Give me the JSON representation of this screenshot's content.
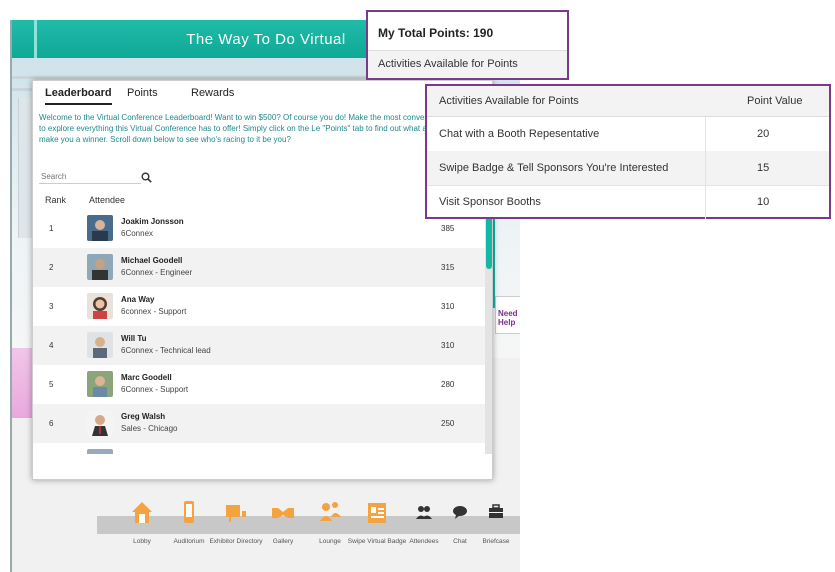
{
  "app": {
    "title": "The Way To Do Virtual",
    "help_sign": "Need Help"
  },
  "leaderboard": {
    "tabs": [
      "Leaderboard",
      "Points",
      "Rewards"
    ],
    "welcome_text": "Welcome to the Virtual Conference Leaderboard! Want to win $500? Of course you do! Make the most convenient opportunity to explore everything this Virtual Conference has to offer! Simply click on the Le \"Points\" tab to find out what actions could make you a winner. Scroll down below to see who's racing to it be you?",
    "search_placeholder": "Search",
    "columns": {
      "rank": "Rank",
      "attendee": "Attendee"
    },
    "rows": [
      {
        "rank": "1",
        "name": "Joakim Jonsson",
        "org": "6Connex",
        "points": "385"
      },
      {
        "rank": "2",
        "name": "Michael Goodell",
        "org": "6Connex - Engineer",
        "points": "315"
      },
      {
        "rank": "3",
        "name": "Ana Way",
        "org": "6connex - Support",
        "points": "310"
      },
      {
        "rank": "4",
        "name": "Will Tu",
        "org": "6Connex - Technical lead",
        "points": "310"
      },
      {
        "rank": "5",
        "name": "Marc Goodell",
        "org": "6Connex - Support",
        "points": "280"
      },
      {
        "rank": "6",
        "name": "Greg Walsh",
        "org": "Sales - Chicago",
        "points": "250"
      }
    ]
  },
  "points_summary": {
    "total": "My Total Points: 190",
    "activities_link": "Activities Available for Points"
  },
  "activities_table": {
    "header_activity": "Activities Available for Points",
    "header_value": "Point Value",
    "rows": [
      {
        "activity": "Chat with a Booth Repesentative",
        "value": "20"
      },
      {
        "activity": "Swipe Badge & Tell Sponsors You're Interested",
        "value": "15"
      },
      {
        "activity": "Visit Sponsor Booths",
        "value": "10"
      }
    ]
  },
  "bottom_nav": [
    {
      "label": "Lobby"
    },
    {
      "label": "Auditorium"
    },
    {
      "label": "Exhibitor Directory"
    },
    {
      "label": "Gallery"
    },
    {
      "label": "Lounge"
    },
    {
      "label": "Swipe Virtual Badge"
    },
    {
      "label": "Attendees"
    },
    {
      "label": "Chat"
    },
    {
      "label": "Briefcase"
    }
  ],
  "colors": {
    "teal": "#13b7a3",
    "orange": "#f4a340",
    "callout_border": "#7a3a8c"
  }
}
